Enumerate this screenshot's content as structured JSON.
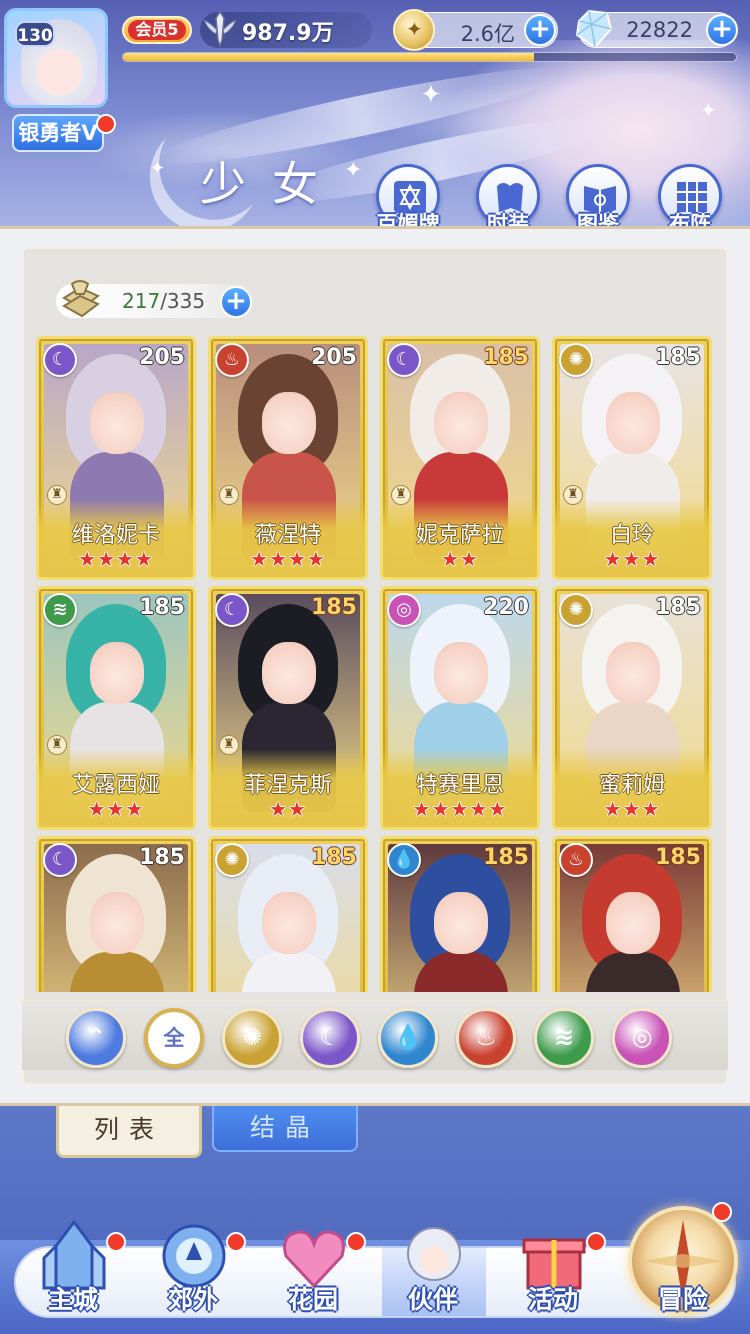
{
  "player": {
    "level": "130",
    "name": "银勇者V",
    "vip": "会员5",
    "power": "987.9万",
    "exp_fraction": 0.67
  },
  "currencies": [
    {
      "name": "gold-coin",
      "value": "2.6亿"
    },
    {
      "name": "diamond",
      "value": "22822"
    }
  ],
  "page": {
    "title": "少女"
  },
  "functions": [
    {
      "icon": "badge-icon",
      "label": "百媚牌"
    },
    {
      "icon": "costume-icon",
      "label": "时装"
    },
    {
      "icon": "gallery-icon",
      "label": "图鉴"
    },
    {
      "icon": "formation-icon",
      "label": "布阵"
    }
  ],
  "collection": {
    "owned": "217",
    "total": "/335"
  },
  "cards": [
    {
      "name": "维洛妮卡",
      "level": "205",
      "element": "moon",
      "stars": "★★★★",
      "gold_level": false,
      "role": true
    },
    {
      "name": "薇涅特",
      "level": "205",
      "element": "fire",
      "stars": "★★★★",
      "gold_level": false,
      "role": true
    },
    {
      "name": "妮克萨拉",
      "level": "185",
      "element": "moon",
      "stars": "★★",
      "gold_level": true,
      "role": true
    },
    {
      "name": "白玲",
      "level": "185",
      "element": "sun",
      "stars": "★★★",
      "gold_level": false,
      "role": true
    },
    {
      "name": "艾露西娅",
      "level": "185",
      "element": "wind",
      "stars": "★★★",
      "gold_level": false,
      "role": true
    },
    {
      "name": "菲涅克斯",
      "level": "185",
      "element": "moon",
      "stars": "★★",
      "gold_level": true,
      "role": true
    },
    {
      "name": "特赛里恩",
      "level": "220",
      "element": "star",
      "stars": "★★★★★",
      "gold_level": false,
      "role": false
    },
    {
      "name": "蜜莉姆",
      "level": "185",
      "element": "sun",
      "stars": "★★★",
      "gold_level": false,
      "role": false
    },
    {
      "name": "",
      "level": "185",
      "element": "moon",
      "stars": "",
      "gold_level": false,
      "role": false
    },
    {
      "name": "",
      "level": "185",
      "element": "sun",
      "stars": "",
      "gold_level": true,
      "role": false
    },
    {
      "name": "",
      "level": "185",
      "element": "water",
      "stars": "",
      "gold_level": true,
      "role": false
    },
    {
      "name": "",
      "level": "185",
      "element": "fire",
      "stars": "",
      "gold_level": true,
      "role": false
    }
  ],
  "filters": [
    {
      "id": "collapse",
      "label": "",
      "color": "#4f7be0"
    },
    {
      "id": "all",
      "label": "全",
      "color": "#ffffff"
    },
    {
      "id": "sun",
      "label": "",
      "color": "#c9a233"
    },
    {
      "id": "moon",
      "label": "",
      "color": "#7b56c9"
    },
    {
      "id": "water",
      "label": "",
      "color": "#2f86cf"
    },
    {
      "id": "fire",
      "label": "",
      "color": "#c9412f"
    },
    {
      "id": "wind",
      "label": "",
      "color": "#3e9b4c"
    },
    {
      "id": "star",
      "label": "",
      "color": "#c952b6"
    }
  ],
  "tabs": {
    "list": "列表",
    "crystal": "结晶"
  },
  "nav": [
    {
      "label": "主城",
      "icon": "castle-icon"
    },
    {
      "label": "郊外",
      "icon": "portal-icon"
    },
    {
      "label": "花园",
      "icon": "garden-heart-icon"
    },
    {
      "label": "伙伴",
      "icon": "partner-icon"
    },
    {
      "label": "活动",
      "icon": "gift-icon"
    },
    {
      "label": "冒险",
      "icon": "compass-icon"
    }
  ]
}
